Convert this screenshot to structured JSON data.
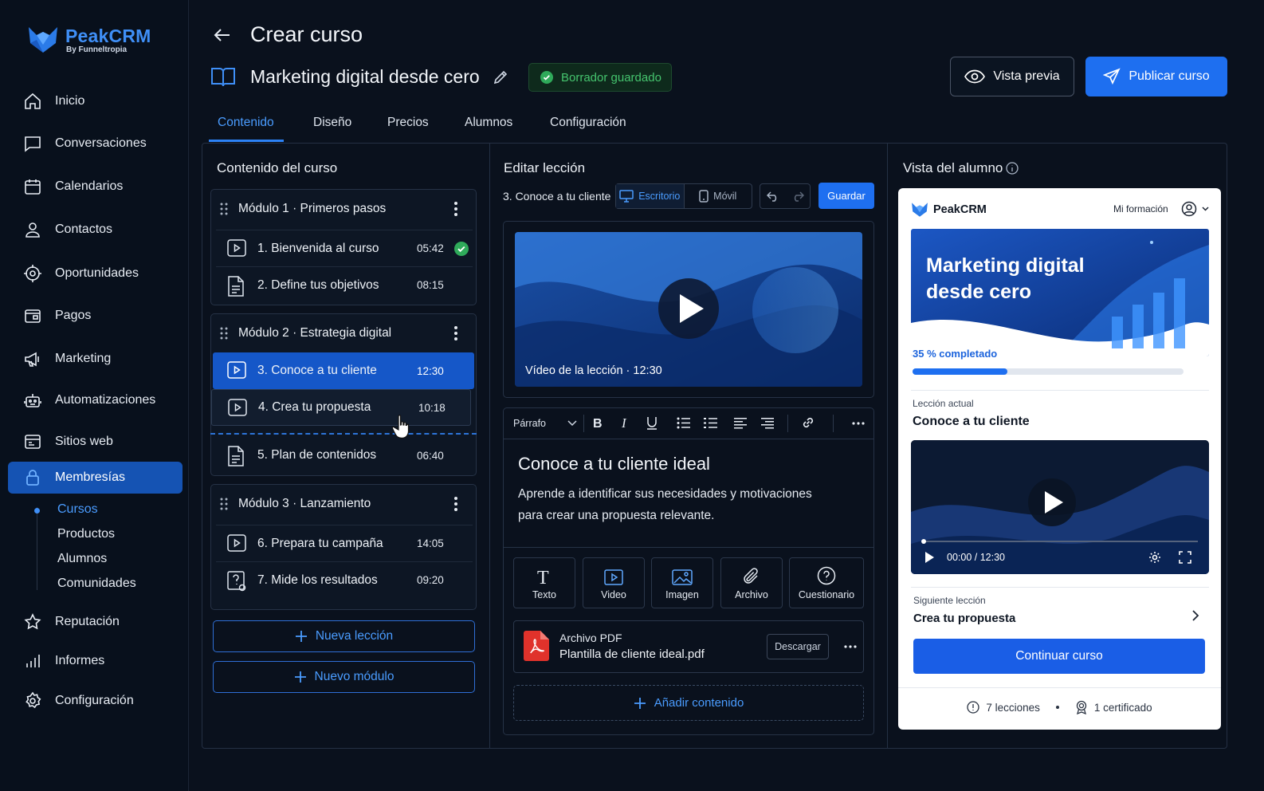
{
  "brand": {
    "name": "PeakCRM",
    "sub": "By Funneltropia"
  },
  "sidebar": {
    "items": [
      {
        "label": "Inicio",
        "icon": "home-icon"
      },
      {
        "label": "Conversaciones",
        "icon": "chat-icon"
      },
      {
        "label": "Calendarios",
        "icon": "calendar-icon"
      },
      {
        "label": "Contactos",
        "icon": "user-icon"
      },
      {
        "label": "Oportunidades",
        "icon": "target-icon"
      },
      {
        "label": "Pagos",
        "icon": "wallet-icon"
      },
      {
        "label": "Marketing",
        "icon": "megaphone-icon"
      },
      {
        "label": "Automatizaciones",
        "icon": "robot-icon"
      },
      {
        "label": "Sitios web",
        "icon": "browser-icon"
      },
      {
        "label": "Membresías",
        "icon": "lock-icon"
      }
    ],
    "sub_items": [
      "Cursos",
      "Productos",
      "Alumnos",
      "Comunidades"
    ],
    "bottom_items": [
      {
        "label": "Reputación",
        "icon": "star-icon"
      },
      {
        "label": "Informes",
        "icon": "bar-chart-icon"
      },
      {
        "label": "Configuración",
        "icon": "gear-icon"
      }
    ]
  },
  "header": {
    "title": "Crear curso",
    "course_name": "Marketing digital desde cero",
    "draft_status": "Borrador guardado",
    "preview_label": "Vista previa",
    "publish_label": "Publicar curso"
  },
  "tabs": [
    "Contenido",
    "Diseño",
    "Precios",
    "Alumnos",
    "Configuración"
  ],
  "content": {
    "title": "Contenido del curso",
    "modules": [
      {
        "title": "Módulo 1 · Primeros pasos",
        "lessons": [
          {
            "title": "1. Bienvenida al curso",
            "time": "05:42",
            "type": "video",
            "done": true
          },
          {
            "title": "2. Define tus objetivos",
            "time": "08:15",
            "type": "document"
          }
        ]
      },
      {
        "title": "Módulo 2 · Estrategia digital",
        "lessons": [
          {
            "title": "3. Conoce a tu cliente",
            "time": "12:30",
            "type": "video"
          },
          {
            "title": "4. Crea tu propuesta",
            "time": "10:18",
            "type": "video"
          },
          {
            "title": "5. Plan de contenidos",
            "time": "06:40",
            "type": "document"
          }
        ]
      },
      {
        "title": "Módulo 3 · Lanzamiento",
        "lessons": [
          {
            "title": "6. Prepara tu campaña",
            "time": "14:05",
            "type": "video"
          },
          {
            "title": "7. Mide los resultados",
            "time": "09:20",
            "type": "quiz"
          }
        ]
      }
    ],
    "new_lesson": "Nueva lección",
    "new_module": "Nuevo módulo"
  },
  "editor": {
    "title": "Editar lección",
    "crumb": "3. Conoce a tu cliente",
    "desktop": "Escritorio",
    "mobile": "Móvil",
    "save": "Guardar",
    "video_caption": "Vídeo de la lección · 12:30",
    "paragraph_select": "Párrafo",
    "heading": "Conoce a tu cliente ideal",
    "paragraph": "Aprende a identificar sus necesidades y motivaciones para crear una propuesta relevante.",
    "blocks": [
      "Texto",
      "Video",
      "Imagen",
      "Archivo",
      "Cuestionario"
    ],
    "file_label": "Archivo PDF",
    "file_name": "Plantilla de cliente ideal.pdf",
    "download": "Descargar",
    "add_content": "Añadir contenido"
  },
  "student": {
    "title": "Vista del alumno",
    "brand": "PeakCRM",
    "my_training": "Mi formación",
    "hero_title": "Marketing digital desde cero",
    "progress_label": "35 % completado",
    "progress": 0.35,
    "current_label": "Lección actual",
    "current_title": "Conoce a tu cliente",
    "video_time": "00:00 / 12:30",
    "next_label": "Siguiente lección",
    "next_title": "Crea tu propuesta",
    "continue": "Continuar curso",
    "lessons_count": "7 lecciones",
    "certificates": "1 certificado"
  },
  "colors": {
    "accent": "#1e6ff0",
    "bg": "#0a111d",
    "success": "#45c46e"
  }
}
